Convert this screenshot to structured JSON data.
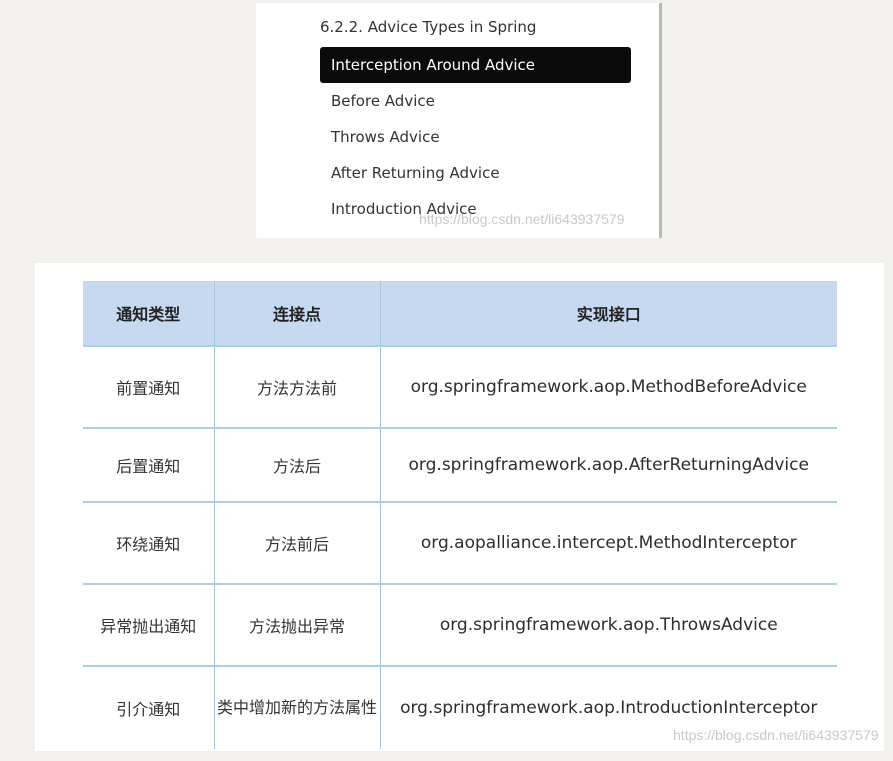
{
  "toc": {
    "heading": "6.2.2. Advice Types in Spring",
    "items": [
      {
        "label": "Interception Around Advice",
        "active": true
      },
      {
        "label": "Before Advice",
        "active": false
      },
      {
        "label": "Throws Advice",
        "active": false
      },
      {
        "label": "After Returning Advice",
        "active": false
      },
      {
        "label": "Introduction Advice",
        "active": false
      }
    ],
    "active_bg": "#0b0b0b"
  },
  "watermark": "https://blog.csdn.net/li643937579",
  "table": {
    "headers": [
      "通知类型",
      "连接点",
      "实现接口"
    ],
    "header_bg": "#c6d9f1",
    "rows": [
      [
        "前置通知",
        "方法方法前",
        "org.springframework.aop.MethodBeforeAdvice"
      ],
      [
        "后置通知",
        "方法后",
        "org.springframework.aop.AfterReturningAdvice"
      ],
      [
        "环绕通知",
        "方法前后",
        "org.aopalliance.intercept.MethodInterceptor"
      ],
      [
        "异常抛出通知",
        "方法抛出异常",
        "org.springframework.aop.ThrowsAdvice"
      ],
      [
        "引介通知",
        "类中增加新的方法属性",
        "org.springframework.aop.IntroductionInterceptor"
      ]
    ]
  }
}
